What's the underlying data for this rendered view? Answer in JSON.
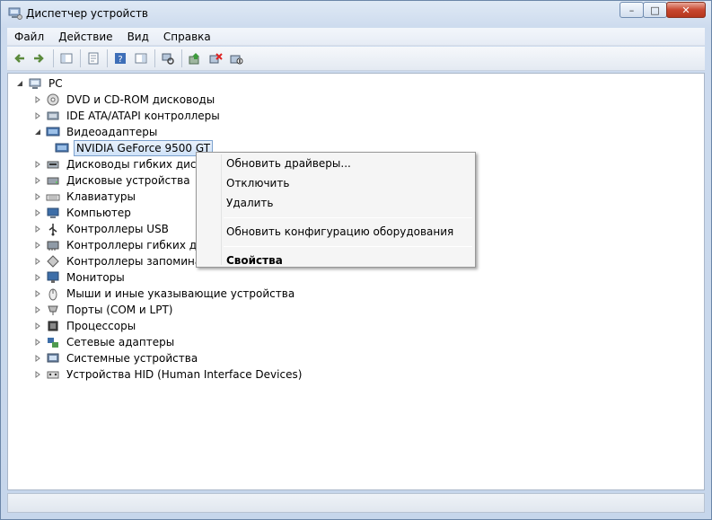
{
  "window": {
    "title": "Диспетчер устройств",
    "minimize": "–",
    "maximize": "□",
    "close": "✕"
  },
  "menu": [
    "Файл",
    "Действие",
    "Вид",
    "Справка"
  ],
  "toolbar": [
    {
      "name": "back-icon"
    },
    {
      "name": "forward-icon"
    },
    {
      "sep": true
    },
    {
      "name": "show-hide-tree-icon"
    },
    {
      "sep": true
    },
    {
      "name": "properties-icon"
    },
    {
      "sep": true
    },
    {
      "name": "help-icon"
    },
    {
      "name": "action-pane-icon"
    },
    {
      "sep": true
    },
    {
      "name": "scan-hardware-icon"
    },
    {
      "sep": true
    },
    {
      "name": "update-driver-icon"
    },
    {
      "name": "uninstall-icon"
    },
    {
      "name": "disable-icon"
    }
  ],
  "tree": {
    "root": "PC",
    "categories": [
      {
        "label": "DVD и CD-ROM дисководы",
        "icon": "dvd-icon",
        "expanded": false
      },
      {
        "label": "IDE ATA/ATAPI контроллеры",
        "icon": "ide-icon",
        "expanded": false
      },
      {
        "label": "Видеоадаптеры",
        "icon": "display-adapter-icon",
        "expanded": true
      },
      {
        "label": "NVIDIA GeForce 9500 GT",
        "icon": "gpu-icon",
        "child": true,
        "selected": true
      },
      {
        "label": "Дисководы гибких дисков",
        "icon": "floppy-icon",
        "expanded": false
      },
      {
        "label": "Дисковые устройства",
        "icon": "disk-icon",
        "expanded": false
      },
      {
        "label": "Клавиатуры",
        "icon": "keyboard-icon",
        "expanded": false
      },
      {
        "label": "Компьютер",
        "icon": "computer-icon",
        "expanded": false
      },
      {
        "label": "Контроллеры USB",
        "icon": "usb-icon",
        "expanded": false
      },
      {
        "label": "Контроллеры гибких диск",
        "icon": "floppy-controller-icon",
        "expanded": false
      },
      {
        "label": "Контроллеры запоминаю",
        "icon": "storage-controller-icon",
        "expanded": false
      },
      {
        "label": "Мониторы",
        "icon": "monitor-icon",
        "expanded": false
      },
      {
        "label": "Мыши и иные указывающие устройства",
        "icon": "mouse-icon",
        "expanded": false
      },
      {
        "label": "Порты (COM и LPT)",
        "icon": "port-icon",
        "expanded": false
      },
      {
        "label": "Процессоры",
        "icon": "cpu-icon",
        "expanded": false
      },
      {
        "label": "Сетевые адаптеры",
        "icon": "network-icon",
        "expanded": false
      },
      {
        "label": "Системные устройства",
        "icon": "system-icon",
        "expanded": false
      },
      {
        "label": "Устройства HID (Human Interface Devices)",
        "icon": "hid-icon",
        "expanded": false
      }
    ]
  },
  "context_menu": {
    "items": [
      {
        "label": "Обновить драйверы...",
        "name": "update-drivers-item"
      },
      {
        "label": "Отключить",
        "name": "disable-item"
      },
      {
        "label": "Удалить",
        "name": "uninstall-item"
      },
      {
        "sep": true
      },
      {
        "label": "Обновить конфигурацию оборудования",
        "name": "scan-changes-item"
      },
      {
        "sep": true
      },
      {
        "label": "Свойства",
        "name": "properties-item",
        "bold": true
      }
    ]
  }
}
